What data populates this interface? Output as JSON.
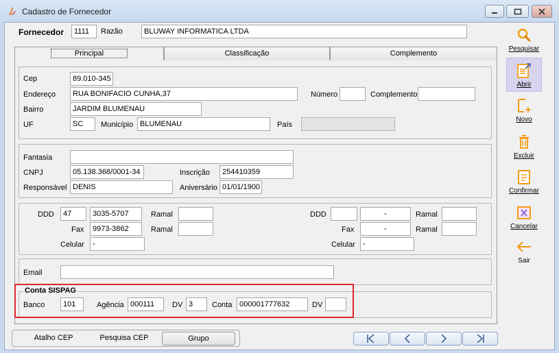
{
  "window": {
    "title": "Cadastro de Fornecedor"
  },
  "header": {
    "fornecedor_label": "Fornecedor",
    "fornecedor_code": "1111",
    "razao_label": "Razão",
    "razao_value": "BLUWAY INFORMATICA LTDA"
  },
  "tabs": [
    {
      "label": "Principal",
      "active": true
    },
    {
      "label": "Classificação",
      "active": false
    },
    {
      "label": "Complemento",
      "active": false
    }
  ],
  "address": {
    "cep_label": "Cep",
    "cep": "89.010-345",
    "endereco_label": "Endereço",
    "endereco": "RUA BONIFACIO CUNHA,37",
    "numero_label": "Número",
    "numero": "",
    "complemento_label": "Complemento",
    "complemento": "",
    "bairro_label": "Bairro",
    "bairro": "JARDIM BLUMENAU",
    "uf_label": "UF",
    "uf": "SC",
    "municipio_label": "Município",
    "municipio": "BLUMENAU",
    "pais_label": "País",
    "pais": ""
  },
  "company": {
    "fantasia_label": "Fantasia",
    "fantasia": "",
    "cnpj_label": "CNPJ",
    "cnpj": "05.138.368/0001-34",
    "inscricao_label": "Inscrição",
    "inscricao": "254410359",
    "responsavel_label": "Responsável",
    "responsavel": "DENIS",
    "aniversario_label": "Aniversário",
    "aniversario": "01/01/1900"
  },
  "phones": {
    "ddd_label": "DDD",
    "ramal_label": "Ramal",
    "fax_label": "Fax",
    "celular_label": "Celular",
    "left": {
      "ddd": "47",
      "telefone": "3035-5707",
      "ramal": "",
      "fax": "9973-3862",
      "fax_ramal": "",
      "celular": "-"
    },
    "right": {
      "ddd": "",
      "telefone": "-",
      "ramal": "",
      "fax": "-",
      "fax_ramal": "",
      "celular": "-"
    }
  },
  "email": {
    "label": "Email",
    "value": ""
  },
  "sispag": {
    "title": "Conta SISPAG",
    "banco_label": "Banco",
    "banco": "101",
    "agencia_label": "Agência",
    "agencia": "000111",
    "dv_label": "DV",
    "dv_agencia": "3",
    "conta_label": "Conta",
    "conta": "000001777632",
    "dv_conta": ""
  },
  "bottom": {
    "atalho_cep": "Atalho CEP",
    "pesquisa_cep": "Pesquisa CEP",
    "grupo": "Grupo"
  },
  "toolbar": [
    {
      "label": "Pesquisar",
      "icon": "magnifier-icon"
    },
    {
      "label": "Abrir",
      "icon": "open-document-icon"
    },
    {
      "label": "Novo",
      "icon": "new-document-icon"
    },
    {
      "label": "Excluir",
      "icon": "delete-icon"
    },
    {
      "label": "Confirmar",
      "icon": "confirm-icon"
    },
    {
      "label": "Cancelar",
      "icon": "cancel-icon"
    },
    {
      "label": "Sair",
      "icon": "exit-arrow-icon"
    }
  ],
  "colors": {
    "highlight": "#e0252b",
    "toolbar_selected": "#d8d4ef",
    "accent": "#f39c12"
  }
}
